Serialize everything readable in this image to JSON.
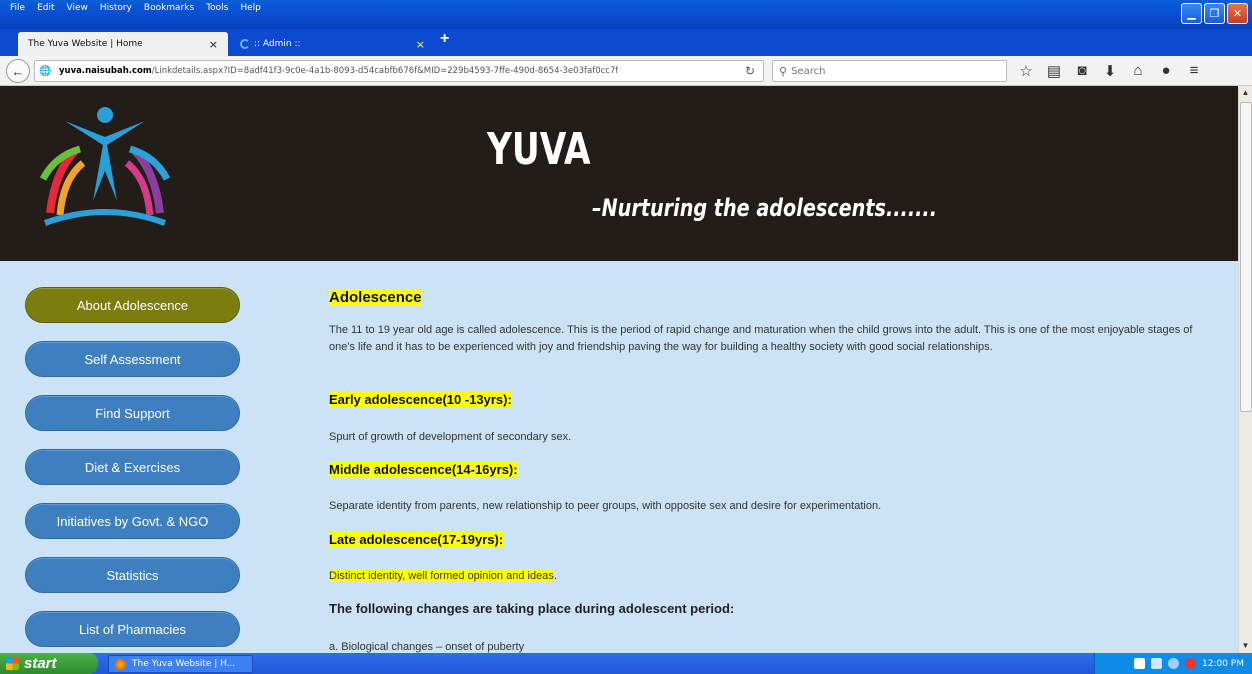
{
  "menu": [
    "File",
    "Edit",
    "View",
    "History",
    "Bookmarks",
    "Tools",
    "Help"
  ],
  "tabs": {
    "active_title": "The Yuva Website | Home",
    "inactive_title": ":: Admin ::",
    "close_glyph": "×",
    "new_tab_glyph": "+"
  },
  "nav": {
    "url_domain": "yuva.naisubah.com",
    "url_path": "/Linkdetails.aspx?ID=8adf41f3-9c0e-4a1b-8093-d54cabfb676f&MID=229b4593-7ffe-490d-8654-3e03faf0cc7f",
    "search_placeholder": "Search"
  },
  "banner": {
    "title": "YUVA",
    "tagline": "–Nurturing the adolescents.......",
    "logo_icon": "yuva-figure-logo"
  },
  "sidebar": {
    "items": [
      {
        "label": "About Adolescence",
        "active": true
      },
      {
        "label": "Self Assessment"
      },
      {
        "label": "Find Support"
      },
      {
        "label": "Diet & Exercises"
      },
      {
        "label": "Initiatives by Govt. & NGO"
      },
      {
        "label": "Statistics"
      },
      {
        "label": "List of Pharmacies"
      }
    ]
  },
  "content": {
    "heading": "Adolescence",
    "intro": "The 11 to 19 year old age is called adolescence. This is the period of rapid change and maturation when the child grows into the adult. This is one of the most enjoyable stages of one's life and it has to be experienced with joy and friendship paving the way for building a healthy society with good social relationships.",
    "early_heading": "Early adolescence(10 -13yrs):",
    "early_text": "Spurt of growth of development of secondary sex.",
    "middle_heading": "Middle adolescence(14-16yrs):",
    "middle_text": "Separate identity from parents, new relationship to peer groups, with opposite sex and desire for experimentation.",
    "late_heading": "Late adolescence(17-19yrs):",
    "late_text": "Distinct identity, well formed opinion and ideas",
    "late_suffix": ".",
    "changes_heading": "The following changes are taking place during adolescent period:",
    "changes_a": "a. Biological changes – onset of puberty"
  },
  "taskbar": {
    "start_label": "start",
    "task_item": "The Yuva Website | H...",
    "clock": "12:00 PM"
  },
  "colors": {
    "active_nav": "#7b7d0e",
    "nav_button": "#3d7fbf",
    "page_bg": "#cce3f5",
    "highlight": "#ffff00",
    "banner_bg": "#221d19"
  }
}
